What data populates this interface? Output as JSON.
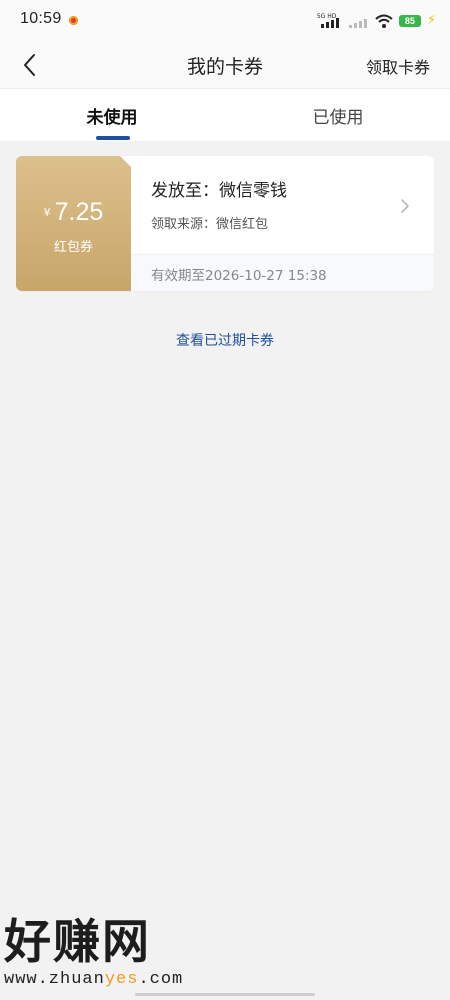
{
  "status_bar": {
    "time": "10:59",
    "network_label": "5G HD",
    "battery_level": "85",
    "icons": [
      "notification-dot-icon",
      "signal-icon",
      "signal-secondary-icon",
      "wifi-icon",
      "battery-icon",
      "charging-icon"
    ]
  },
  "nav": {
    "title": "我的卡券",
    "action_label": "领取卡券",
    "back_icon": "chevron-left-icon"
  },
  "tabs": [
    {
      "label": "未使用",
      "active": true
    },
    {
      "label": "已使用",
      "active": false
    }
  ],
  "coupon": {
    "currency": "¥",
    "amount": "7.25",
    "type_label": "红包券",
    "issue_to": "发放至：微信零钱",
    "source": "领取来源：微信红包",
    "expiry": "有效期至2026-10-27 15:38",
    "gold_color": "#d4b57c"
  },
  "view_expired_label": "查看已过期卡券",
  "watermark": {
    "title": "好赚网",
    "url_prefix": "www.zhuan",
    "url_highlight": "yes",
    "url_suffix": ".com"
  },
  "colors": {
    "accent_blue": "#1d4fa0",
    "battery_green": "#39b54a"
  }
}
